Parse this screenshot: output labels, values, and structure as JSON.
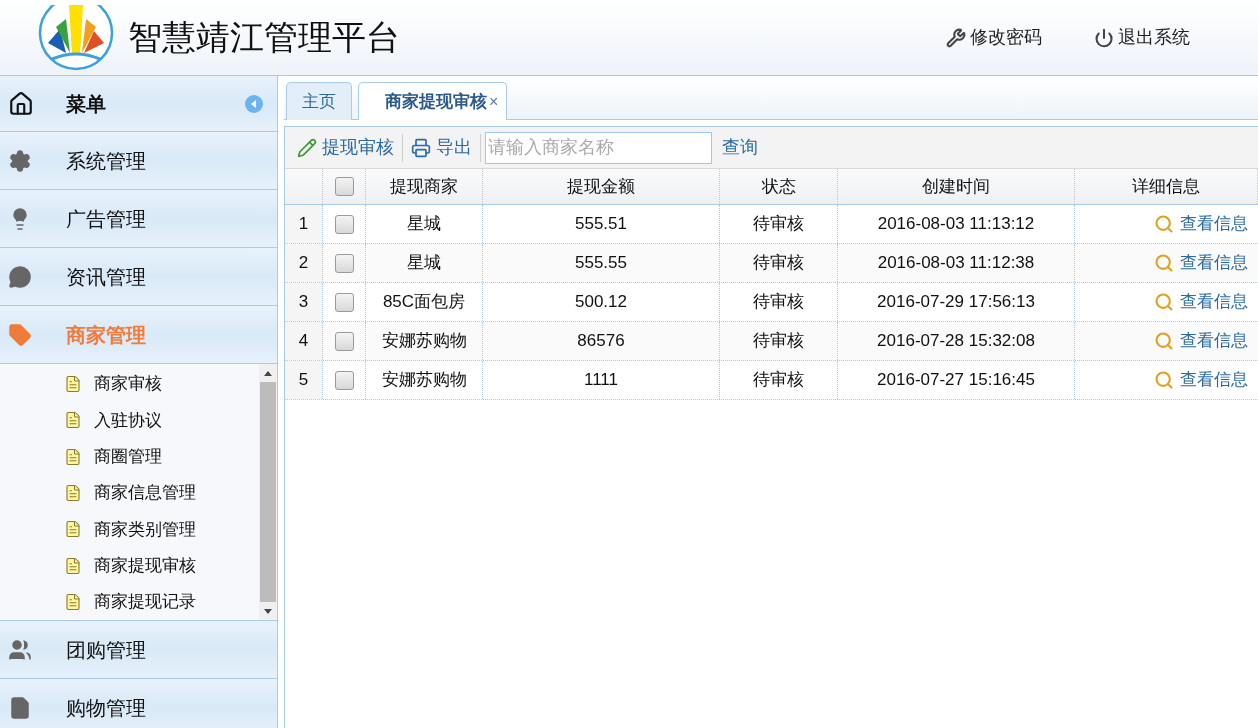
{
  "header": {
    "title": "智慧靖江管理平台",
    "actions": [
      {
        "kind": "password",
        "label": "修改密码"
      },
      {
        "kind": "logout",
        "label": "退出系统"
      }
    ]
  },
  "sidebar": {
    "title": "菜单",
    "groups": [
      {
        "kind": "settings",
        "label": "系统管理",
        "expanded": false
      },
      {
        "kind": "bulb",
        "label": "广告管理",
        "expanded": false
      },
      {
        "kind": "chat",
        "label": "资讯管理",
        "expanded": false
      },
      {
        "kind": "tag",
        "label": "商家管理",
        "expanded": true,
        "children": [
          {
            "label": "商家审核"
          },
          {
            "label": "入驻协议"
          },
          {
            "label": "商圈管理"
          },
          {
            "label": "商家信息管理"
          },
          {
            "label": "商家类别管理"
          },
          {
            "label": "商家提现审核"
          },
          {
            "label": "商家提现记录"
          }
        ]
      },
      {
        "kind": "group",
        "label": "团购管理",
        "expanded": false
      },
      {
        "kind": "doc",
        "label": "购物管理",
        "expanded": false
      }
    ]
  },
  "tabs": [
    {
      "label": "主页",
      "selected": false
    },
    {
      "label": "商家提现审核",
      "selected": true,
      "close": "×"
    }
  ],
  "toolbar": {
    "buttons": [
      {
        "kind": "edit",
        "label": "提现审核"
      },
      {
        "kind": "print",
        "label": "导出"
      }
    ],
    "search": {
      "placeholder": "请输入商家名称"
    },
    "query": "查询"
  },
  "table": {
    "header_checked": false,
    "columns": [
      "提现商家",
      "提现金额",
      "状态",
      "创建时间",
      "详细信息"
    ],
    "rows": [
      {
        "index": "1",
        "checked": false,
        "merchant": "星城",
        "amount": "555.51",
        "status": "待审核",
        "created": "2016-08-03 11:13:12",
        "detail": "查看信息"
      },
      {
        "index": "2",
        "checked": false,
        "merchant": "星城",
        "amount": "555.55",
        "status": "待审核",
        "created": "2016-08-03 11:12:38",
        "detail": "查看信息"
      },
      {
        "index": "3",
        "checked": false,
        "merchant": "85C面包房",
        "amount": "500.12",
        "status": "待审核",
        "created": "2016-07-29 17:56:13",
        "detail": "查看信息"
      },
      {
        "index": "4",
        "checked": false,
        "merchant": "安娜苏购物",
        "amount": "86576",
        "status": "待审核",
        "created": "2016-07-28 15:32:08",
        "detail": "查看信息"
      },
      {
        "index": "5",
        "checked": false,
        "merchant": "安娜苏购物",
        "amount": "1111",
        "status": "待审核",
        "created": "2016-07-27 15:16:45",
        "detail": "查看信息"
      }
    ]
  }
}
